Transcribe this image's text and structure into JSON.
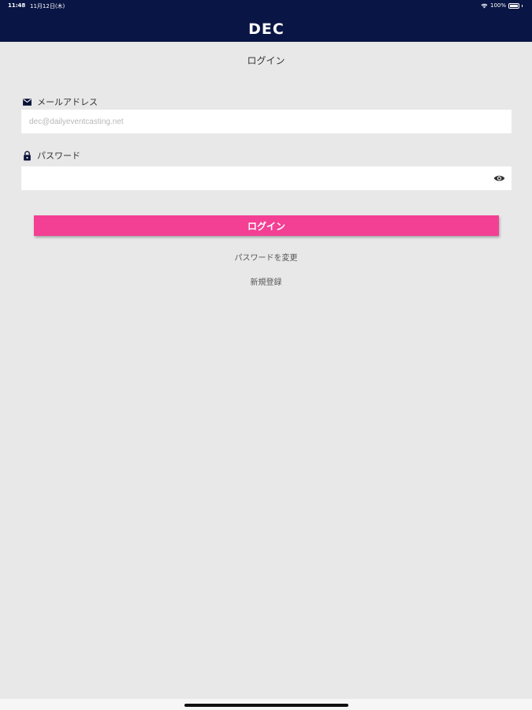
{
  "status_bar": {
    "time": "11:48",
    "date": "11月12日(木)",
    "battery": "100%",
    "icons": [
      "wifi-icon",
      "battery-icon"
    ]
  },
  "header": {
    "logo_text": "DEC",
    "background": "#091544"
  },
  "page_title": "ログイン",
  "email": {
    "label": "メールアドレス",
    "icon": "mail-icon",
    "placeholder": "dec@dailyeventcasting.net",
    "value": ""
  },
  "password": {
    "label": "パスワード",
    "icon": "lock-icon",
    "value": "",
    "toggle_icon": "eye-icon"
  },
  "login_button": {
    "label": "ログイン",
    "color": "#f33f94"
  },
  "links": {
    "change_password": "パスワードを変更",
    "register": "新規登録"
  }
}
